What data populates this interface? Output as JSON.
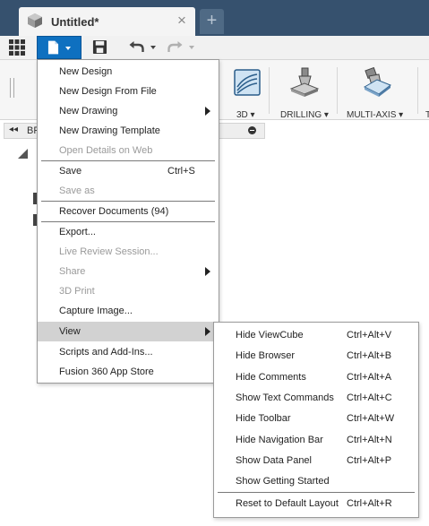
{
  "tab": {
    "title": "Untitled*",
    "close": "×",
    "new_tab": "+"
  },
  "toolbar": {
    "tools": [
      {
        "label": "3D ▾"
      },
      {
        "label": "DRILLING ▾"
      },
      {
        "label": "MULTI-AXIS ▾"
      },
      {
        "label": "T"
      }
    ]
  },
  "browser": {
    "arrows": "◂◂",
    "label": "BR"
  },
  "file_menu": {
    "items": [
      {
        "label": "New Design",
        "shortcut": "",
        "disabled": false,
        "submenu": false
      },
      {
        "label": "New Design From File",
        "shortcut": "",
        "disabled": false,
        "submenu": false
      },
      {
        "label": "New Drawing",
        "shortcut": "",
        "disabled": false,
        "submenu": true
      },
      {
        "label": "New Drawing Template",
        "shortcut": "",
        "disabled": false,
        "submenu": false
      },
      {
        "label": "Open Details on Web",
        "shortcut": "",
        "disabled": true,
        "submenu": false
      },
      {
        "label": "Save",
        "shortcut": "Ctrl+S",
        "disabled": false,
        "submenu": false
      },
      {
        "label": "Save as",
        "shortcut": "",
        "disabled": true,
        "submenu": false
      },
      {
        "label": "Recover Documents (94)",
        "shortcut": "",
        "disabled": false,
        "submenu": false
      },
      {
        "label": "Export...",
        "shortcut": "",
        "disabled": false,
        "submenu": false
      },
      {
        "label": "Live Review Session...",
        "shortcut": "",
        "disabled": true,
        "submenu": false
      },
      {
        "label": "Share",
        "shortcut": "",
        "disabled": true,
        "submenu": true
      },
      {
        "label": "3D Print",
        "shortcut": "",
        "disabled": true,
        "submenu": false
      },
      {
        "label": "Capture Image...",
        "shortcut": "",
        "disabled": false,
        "submenu": false
      },
      {
        "label": "View",
        "shortcut": "",
        "disabled": false,
        "submenu": true,
        "highlighted": true
      },
      {
        "label": "Scripts and Add-Ins...",
        "shortcut": "",
        "disabled": false,
        "submenu": false
      },
      {
        "label": "Fusion 360 App Store",
        "shortcut": "",
        "disabled": false,
        "submenu": false
      }
    ]
  },
  "view_menu": {
    "items": [
      {
        "label": "Hide ViewCube",
        "shortcut": "Ctrl+Alt+V"
      },
      {
        "label": "Hide Browser",
        "shortcut": "Ctrl+Alt+B"
      },
      {
        "label": "Hide Comments",
        "shortcut": "Ctrl+Alt+A"
      },
      {
        "label": "Show Text Commands",
        "shortcut": "Ctrl+Alt+C"
      },
      {
        "label": "Hide Toolbar",
        "shortcut": "Ctrl+Alt+W"
      },
      {
        "label": "Hide Navigation Bar",
        "shortcut": "Ctrl+Alt+N"
      },
      {
        "label": "Show Data Panel",
        "shortcut": "Ctrl+Alt+P"
      },
      {
        "label": "Show Getting Started",
        "shortcut": ""
      },
      {
        "label": "Reset to Default Layout",
        "shortcut": "Ctrl+Alt+R"
      }
    ]
  },
  "colors": {
    "tabbar": "#36516e",
    "file_button": "#0e70c0",
    "menu_highlight": "#d2d2d2",
    "disabled_text": "#9a9a9a"
  }
}
